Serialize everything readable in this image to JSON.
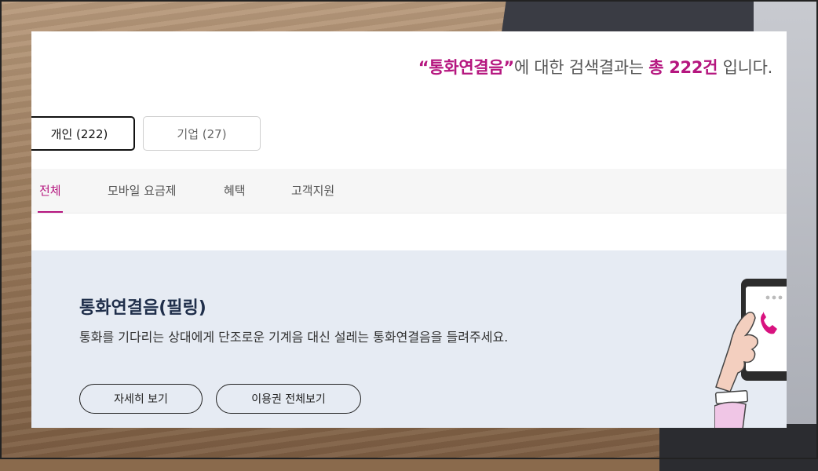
{
  "search_result": {
    "prefix_quote": "“통화연결음”",
    "middle": "에 대한 검색결과는 ",
    "total": "총 222건",
    "suffix": " 입니다."
  },
  "segment_tabs": [
    {
      "label": "개인 (222)",
      "active": true
    },
    {
      "label": "기업 (27)",
      "active": false
    }
  ],
  "category_tabs": [
    {
      "label": "전체",
      "active": true
    },
    {
      "label": "모바일 요금제",
      "active": false
    },
    {
      "label": "혜택",
      "active": false
    },
    {
      "label": "고객지원",
      "active": false
    }
  ],
  "banner": {
    "title": "통화연결음(필링)",
    "description": "통화를 기다리는 상대에게 단조로운 기계음 대신 설레는 통화연결음을 들려주세요.",
    "detail_button": "자세히 보기",
    "all_passes_button": "이용권 전체보기",
    "illustration": "hand-holding-phone-icon"
  },
  "colors": {
    "accent": "#b5167f",
    "banner_bg": "#e6ebf3",
    "title": "#1f2e4a"
  }
}
